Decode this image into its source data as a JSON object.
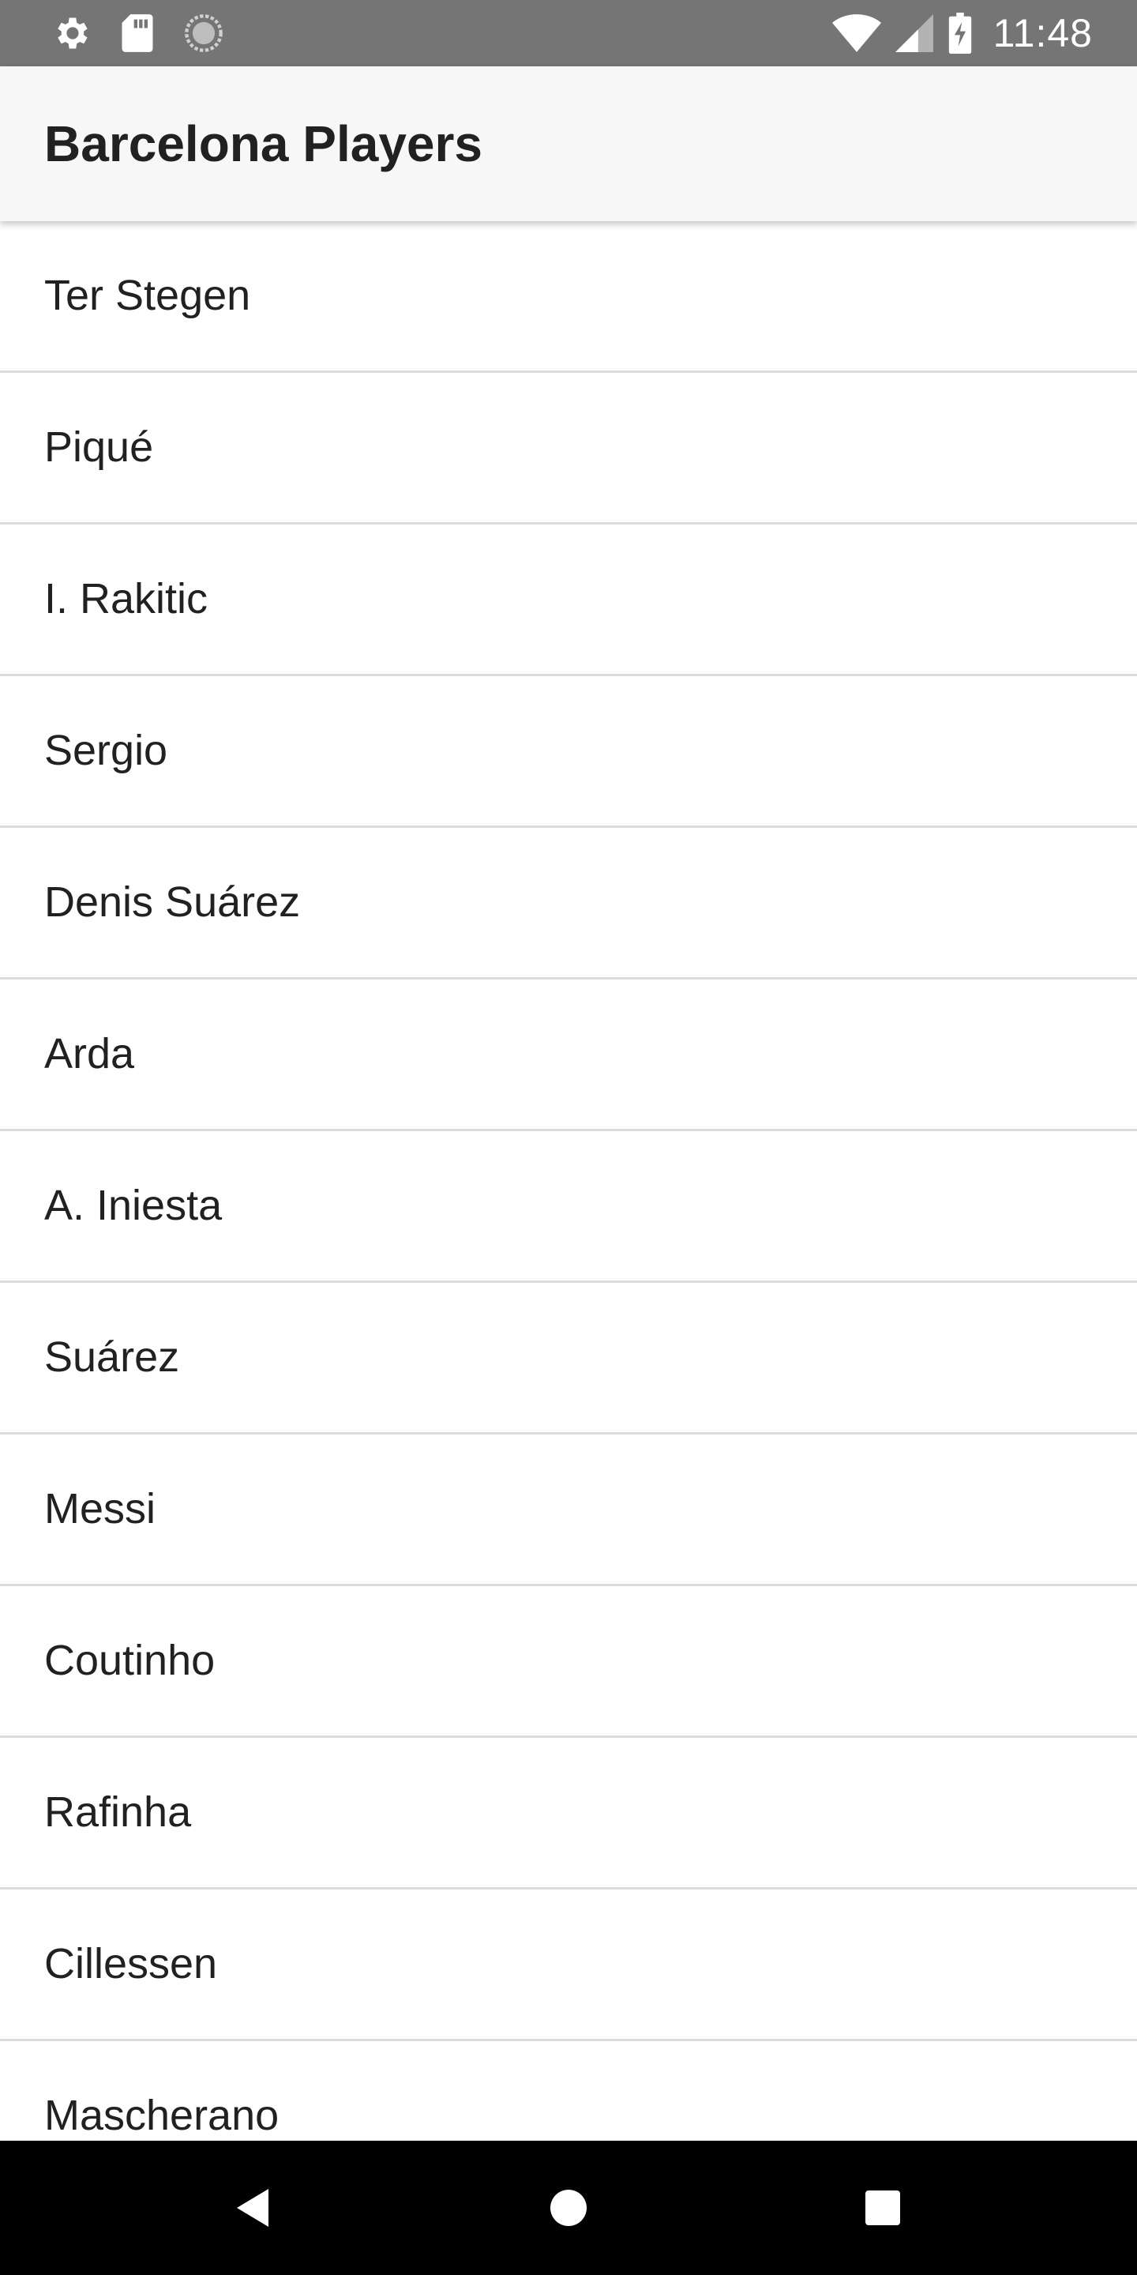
{
  "status_bar": {
    "time": "11:48",
    "icons": [
      "settings-icon",
      "sd-card-icon",
      "sync-icon",
      "wifi-icon",
      "signal-icon",
      "battery-charging-icon"
    ]
  },
  "app_bar": {
    "title": "Barcelona Players"
  },
  "players": [
    "Ter Stegen",
    "Piqué",
    "I. Rakitic",
    "Sergio",
    "Denis Suárez",
    "Arda",
    "A. Iniesta",
    "Suárez",
    "Messi",
    "Coutinho",
    "Rafinha",
    "Cillessen",
    "Mascherano"
  ],
  "nav_bar": {
    "buttons": [
      "back-icon",
      "home-icon",
      "recents-icon"
    ]
  },
  "colors": {
    "status_bar": "#757575",
    "app_bar": "#f7f7f7",
    "divider": "#dcdcdc",
    "nav_bar": "#000000",
    "text": "#212121"
  }
}
